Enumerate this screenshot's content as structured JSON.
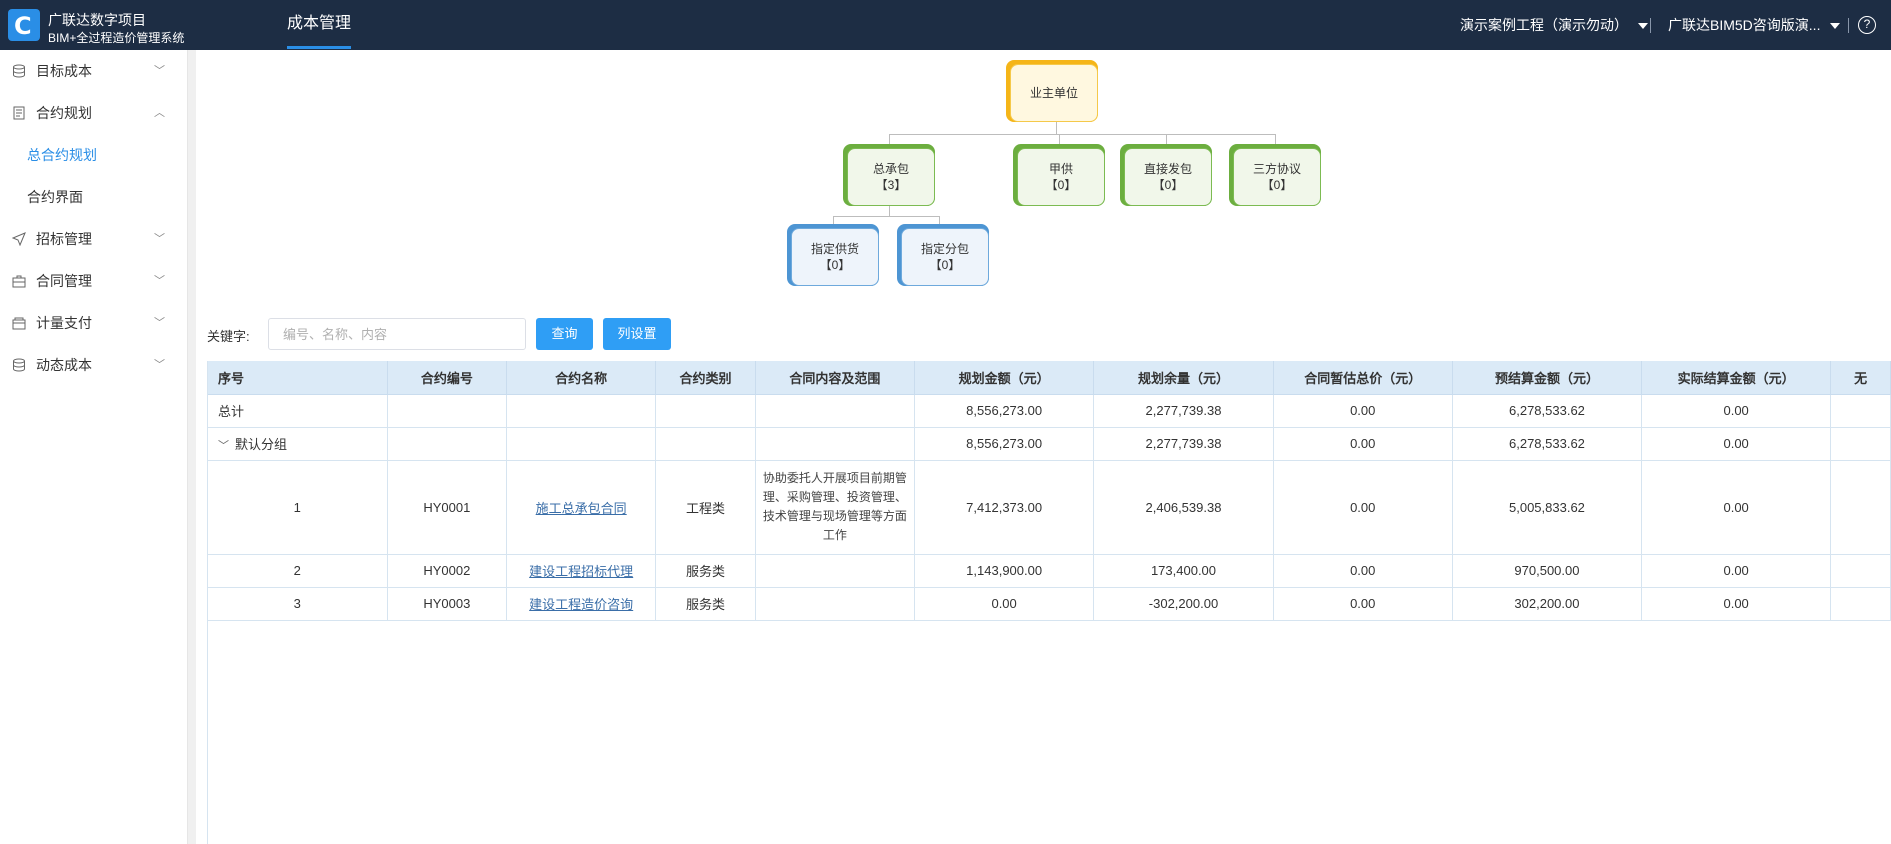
{
  "header": {
    "brand_title": "广联达数字项目",
    "brand_subtitle": "BIM+全过程造价管理系统",
    "logo_letter": "C",
    "active_tab": "成本管理",
    "project_select": "演示案例工程（演示勿动）",
    "user_select": "广联达BIM5D咨询版演...",
    "help_icon": "?"
  },
  "sidebar": {
    "items": [
      {
        "label": "目标成本",
        "icon": "database-icon",
        "arrow": "﹀"
      },
      {
        "label": "合约规划",
        "icon": "document-icon",
        "arrow": "︿"
      },
      {
        "label": "招标管理",
        "icon": "send-icon",
        "arrow": "﹀"
      },
      {
        "label": "合同管理",
        "icon": "briefcase-icon",
        "arrow": "﹀"
      },
      {
        "label": "计量支付",
        "icon": "wallet-icon",
        "arrow": "﹀"
      },
      {
        "label": "动态成本",
        "icon": "database-icon",
        "arrow": "﹀"
      }
    ],
    "subitems": [
      {
        "label": "总合约规划",
        "active": true
      },
      {
        "label": "合约界面",
        "active": false
      }
    ]
  },
  "orgchart": {
    "root": {
      "title": "业主单位"
    },
    "level1": [
      {
        "title": "总承包",
        "count": "【3】"
      },
      {
        "title": "甲供",
        "count": "【0】"
      },
      {
        "title": "直接发包",
        "count": "【0】"
      },
      {
        "title": "三方协议",
        "count": "【0】"
      }
    ],
    "level2": [
      {
        "title": "指定供货",
        "count": "【0】"
      },
      {
        "title": "指定分包",
        "count": "【0】"
      }
    ]
  },
  "search": {
    "label": "关键字:",
    "placeholder": "编号、名称、内容",
    "query_button": "查询",
    "columns_button": "列设置"
  },
  "table": {
    "headers": [
      "序号",
      "合约编号",
      "合约名称",
      "合约类别",
      "合同内容及范围",
      "规划金额（元）",
      "规划余量（元）",
      "合同暂估总价（元）",
      "预结算金额（元）",
      "实际结算金额（元）",
      "无"
    ],
    "total_row": {
      "label": "总计",
      "plan_amount": "8,556,273.00",
      "plan_remain": "2,277,739.38",
      "provisional": "0.00",
      "pre_settle": "6,278,533.62",
      "actual_settle": "0.00"
    },
    "group_row": {
      "label": "默认分组",
      "plan_amount": "8,556,273.00",
      "plan_remain": "2,277,739.38",
      "provisional": "0.00",
      "pre_settle": "6,278,533.62",
      "actual_settle": "0.00"
    },
    "rows": [
      {
        "seq": "1",
        "code": "HY0001",
        "name": "施工总承包合同",
        "category": "工程类",
        "scope": "协助委托人开展项目前期管理、采购管理、投资管理、技术管理与现场管理等方面工作",
        "plan_amount": "7,412,373.00",
        "plan_remain": "2,406,539.38",
        "provisional": "0.00",
        "pre_settle": "5,005,833.62",
        "actual_settle": "0.00"
      },
      {
        "seq": "2",
        "code": "HY0002",
        "name": "建设工程招标代理",
        "category": "服务类",
        "scope": "",
        "plan_amount": "1,143,900.00",
        "plan_remain": "173,400.00",
        "provisional": "0.00",
        "pre_settle": "970,500.00",
        "actual_settle": "0.00"
      },
      {
        "seq": "3",
        "code": "HY0003",
        "name": "建设工程造价咨询",
        "category": "服务类",
        "scope": "",
        "plan_amount": "0.00",
        "plan_remain": "-302,200.00",
        "provisional": "0.00",
        "pre_settle": "302,200.00",
        "actual_settle": "0.00"
      }
    ]
  }
}
